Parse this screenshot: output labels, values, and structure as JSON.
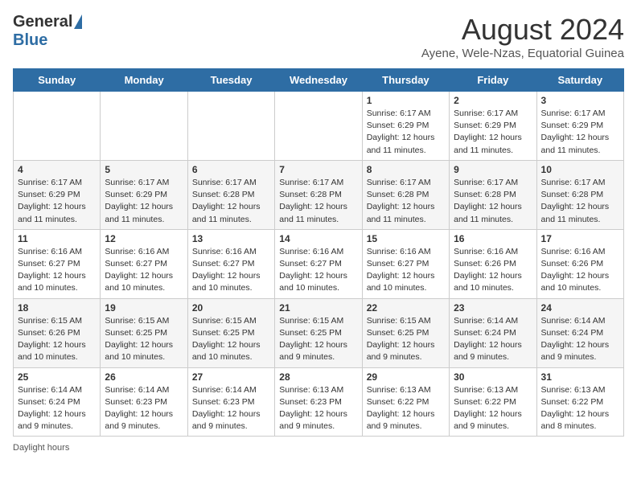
{
  "header": {
    "logo_general": "General",
    "logo_blue": "Blue",
    "month_title": "August 2024",
    "subtitle": "Ayene, Wele-Nzas, Equatorial Guinea"
  },
  "days_of_week": [
    "Sunday",
    "Monday",
    "Tuesday",
    "Wednesday",
    "Thursday",
    "Friday",
    "Saturday"
  ],
  "footer_text": "Daylight hours",
  "weeks": [
    [
      {
        "day": "",
        "sunrise": "",
        "sunset": "",
        "daylight": ""
      },
      {
        "day": "",
        "sunrise": "",
        "sunset": "",
        "daylight": ""
      },
      {
        "day": "",
        "sunrise": "",
        "sunset": "",
        "daylight": ""
      },
      {
        "day": "",
        "sunrise": "",
        "sunset": "",
        "daylight": ""
      },
      {
        "day": "1",
        "sunrise": "Sunrise: 6:17 AM",
        "sunset": "Sunset: 6:29 PM",
        "daylight": "Daylight: 12 hours and 11 minutes."
      },
      {
        "day": "2",
        "sunrise": "Sunrise: 6:17 AM",
        "sunset": "Sunset: 6:29 PM",
        "daylight": "Daylight: 12 hours and 11 minutes."
      },
      {
        "day": "3",
        "sunrise": "Sunrise: 6:17 AM",
        "sunset": "Sunset: 6:29 PM",
        "daylight": "Daylight: 12 hours and 11 minutes."
      }
    ],
    [
      {
        "day": "4",
        "sunrise": "Sunrise: 6:17 AM",
        "sunset": "Sunset: 6:29 PM",
        "daylight": "Daylight: 12 hours and 11 minutes."
      },
      {
        "day": "5",
        "sunrise": "Sunrise: 6:17 AM",
        "sunset": "Sunset: 6:29 PM",
        "daylight": "Daylight: 12 hours and 11 minutes."
      },
      {
        "day": "6",
        "sunrise": "Sunrise: 6:17 AM",
        "sunset": "Sunset: 6:28 PM",
        "daylight": "Daylight: 12 hours and 11 minutes."
      },
      {
        "day": "7",
        "sunrise": "Sunrise: 6:17 AM",
        "sunset": "Sunset: 6:28 PM",
        "daylight": "Daylight: 12 hours and 11 minutes."
      },
      {
        "day": "8",
        "sunrise": "Sunrise: 6:17 AM",
        "sunset": "Sunset: 6:28 PM",
        "daylight": "Daylight: 12 hours and 11 minutes."
      },
      {
        "day": "9",
        "sunrise": "Sunrise: 6:17 AM",
        "sunset": "Sunset: 6:28 PM",
        "daylight": "Daylight: 12 hours and 11 minutes."
      },
      {
        "day": "10",
        "sunrise": "Sunrise: 6:17 AM",
        "sunset": "Sunset: 6:28 PM",
        "daylight": "Daylight: 12 hours and 11 minutes."
      }
    ],
    [
      {
        "day": "11",
        "sunrise": "Sunrise: 6:16 AM",
        "sunset": "Sunset: 6:27 PM",
        "daylight": "Daylight: 12 hours and 10 minutes."
      },
      {
        "day": "12",
        "sunrise": "Sunrise: 6:16 AM",
        "sunset": "Sunset: 6:27 PM",
        "daylight": "Daylight: 12 hours and 10 minutes."
      },
      {
        "day": "13",
        "sunrise": "Sunrise: 6:16 AM",
        "sunset": "Sunset: 6:27 PM",
        "daylight": "Daylight: 12 hours and 10 minutes."
      },
      {
        "day": "14",
        "sunrise": "Sunrise: 6:16 AM",
        "sunset": "Sunset: 6:27 PM",
        "daylight": "Daylight: 12 hours and 10 minutes."
      },
      {
        "day": "15",
        "sunrise": "Sunrise: 6:16 AM",
        "sunset": "Sunset: 6:27 PM",
        "daylight": "Daylight: 12 hours and 10 minutes."
      },
      {
        "day": "16",
        "sunrise": "Sunrise: 6:16 AM",
        "sunset": "Sunset: 6:26 PM",
        "daylight": "Daylight: 12 hours and 10 minutes."
      },
      {
        "day": "17",
        "sunrise": "Sunrise: 6:16 AM",
        "sunset": "Sunset: 6:26 PM",
        "daylight": "Daylight: 12 hours and 10 minutes."
      }
    ],
    [
      {
        "day": "18",
        "sunrise": "Sunrise: 6:15 AM",
        "sunset": "Sunset: 6:26 PM",
        "daylight": "Daylight: 12 hours and 10 minutes."
      },
      {
        "day": "19",
        "sunrise": "Sunrise: 6:15 AM",
        "sunset": "Sunset: 6:25 PM",
        "daylight": "Daylight: 12 hours and 10 minutes."
      },
      {
        "day": "20",
        "sunrise": "Sunrise: 6:15 AM",
        "sunset": "Sunset: 6:25 PM",
        "daylight": "Daylight: 12 hours and 10 minutes."
      },
      {
        "day": "21",
        "sunrise": "Sunrise: 6:15 AM",
        "sunset": "Sunset: 6:25 PM",
        "daylight": "Daylight: 12 hours and 9 minutes."
      },
      {
        "day": "22",
        "sunrise": "Sunrise: 6:15 AM",
        "sunset": "Sunset: 6:25 PM",
        "daylight": "Daylight: 12 hours and 9 minutes."
      },
      {
        "day": "23",
        "sunrise": "Sunrise: 6:14 AM",
        "sunset": "Sunset: 6:24 PM",
        "daylight": "Daylight: 12 hours and 9 minutes."
      },
      {
        "day": "24",
        "sunrise": "Sunrise: 6:14 AM",
        "sunset": "Sunset: 6:24 PM",
        "daylight": "Daylight: 12 hours and 9 minutes."
      }
    ],
    [
      {
        "day": "25",
        "sunrise": "Sunrise: 6:14 AM",
        "sunset": "Sunset: 6:24 PM",
        "daylight": "Daylight: 12 hours and 9 minutes."
      },
      {
        "day": "26",
        "sunrise": "Sunrise: 6:14 AM",
        "sunset": "Sunset: 6:23 PM",
        "daylight": "Daylight: 12 hours and 9 minutes."
      },
      {
        "day": "27",
        "sunrise": "Sunrise: 6:14 AM",
        "sunset": "Sunset: 6:23 PM",
        "daylight": "Daylight: 12 hours and 9 minutes."
      },
      {
        "day": "28",
        "sunrise": "Sunrise: 6:13 AM",
        "sunset": "Sunset: 6:23 PM",
        "daylight": "Daylight: 12 hours and 9 minutes."
      },
      {
        "day": "29",
        "sunrise": "Sunrise: 6:13 AM",
        "sunset": "Sunset: 6:22 PM",
        "daylight": "Daylight: 12 hours and 9 minutes."
      },
      {
        "day": "30",
        "sunrise": "Sunrise: 6:13 AM",
        "sunset": "Sunset: 6:22 PM",
        "daylight": "Daylight: 12 hours and 9 minutes."
      },
      {
        "day": "31",
        "sunrise": "Sunrise: 6:13 AM",
        "sunset": "Sunset: 6:22 PM",
        "daylight": "Daylight: 12 hours and 8 minutes."
      }
    ]
  ]
}
